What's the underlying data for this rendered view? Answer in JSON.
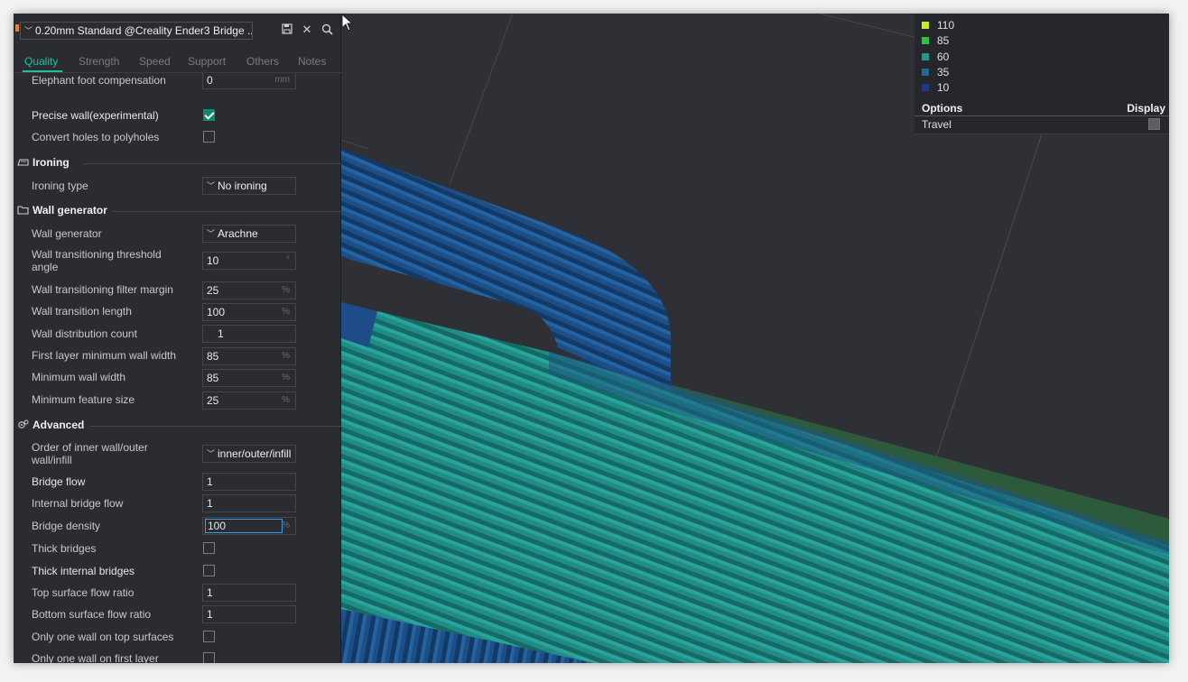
{
  "preset": {
    "name": "0.20mm Standard @Creality Ender3 Bridge ...",
    "icons": [
      "save-icon",
      "close-icon",
      "search-icon"
    ]
  },
  "tabs": [
    "Quality",
    "Strength",
    "Speed",
    "Support",
    "Others",
    "Notes"
  ],
  "active_tab": "Quality",
  "top_rows": {
    "elephant_label": "Elephant foot compensation",
    "elephant_value": "0",
    "elephant_unit": "mm",
    "precise_label": "Precise wall(experimental)",
    "convert_label": "Convert holes to polyholes"
  },
  "ironing": {
    "title": "Ironing",
    "type_label": "Ironing type",
    "type_value": "No ironing"
  },
  "wall_generator": {
    "title": "Wall generator",
    "generator_label": "Wall generator",
    "generator_value": "Arachne",
    "threshold_label": "Wall transitioning threshold angle",
    "threshold_value": "10",
    "threshold_unit": "°",
    "filter_label": "Wall transitioning filter margin",
    "filter_value": "25",
    "filter_unit": "%",
    "length_label": "Wall transition length",
    "length_value": "100",
    "length_unit": "%",
    "distribution_label": "Wall distribution count",
    "distribution_value": "1",
    "first_layer_label": "First layer minimum wall width",
    "first_layer_value": "85",
    "first_layer_unit": "%",
    "min_width_label": "Minimum wall width",
    "min_width_value": "85",
    "min_width_unit": "%",
    "min_feature_label": "Minimum feature size",
    "min_feature_value": "25",
    "min_feature_unit": "%"
  },
  "advanced": {
    "title": "Advanced",
    "order_label": "Order of inner wall/outer wall/infill",
    "order_value": "inner/outer/infill",
    "bridge_flow_label": "Bridge flow",
    "bridge_flow_value": "1",
    "internal_bridge_flow_label": "Internal bridge flow",
    "internal_bridge_flow_value": "1",
    "bridge_density_label": "Bridge density",
    "bridge_density_value": "100",
    "bridge_density_unit": "%",
    "thick_bridges_label": "Thick bridges",
    "thick_internal_label": "Thick internal bridges",
    "top_flow_label": "Top surface flow ratio",
    "top_flow_value": "1",
    "bottom_flow_label": "Bottom surface flow ratio",
    "bottom_flow_value": "1",
    "one_wall_top_label": "Only one wall on top surfaces",
    "one_wall_first_label": "Only one wall on first layer"
  },
  "legend": {
    "items": [
      {
        "value": "110",
        "color": "#c6ef2a"
      },
      {
        "value": "85",
        "color": "#27c93a"
      },
      {
        "value": "60",
        "color": "#1f9a8f"
      },
      {
        "value": "35",
        "color": "#1f6a95"
      },
      {
        "value": "10",
        "color": "#183b8c"
      }
    ],
    "options_label": "Options",
    "display_label": "Display",
    "travel_label": "Travel"
  }
}
